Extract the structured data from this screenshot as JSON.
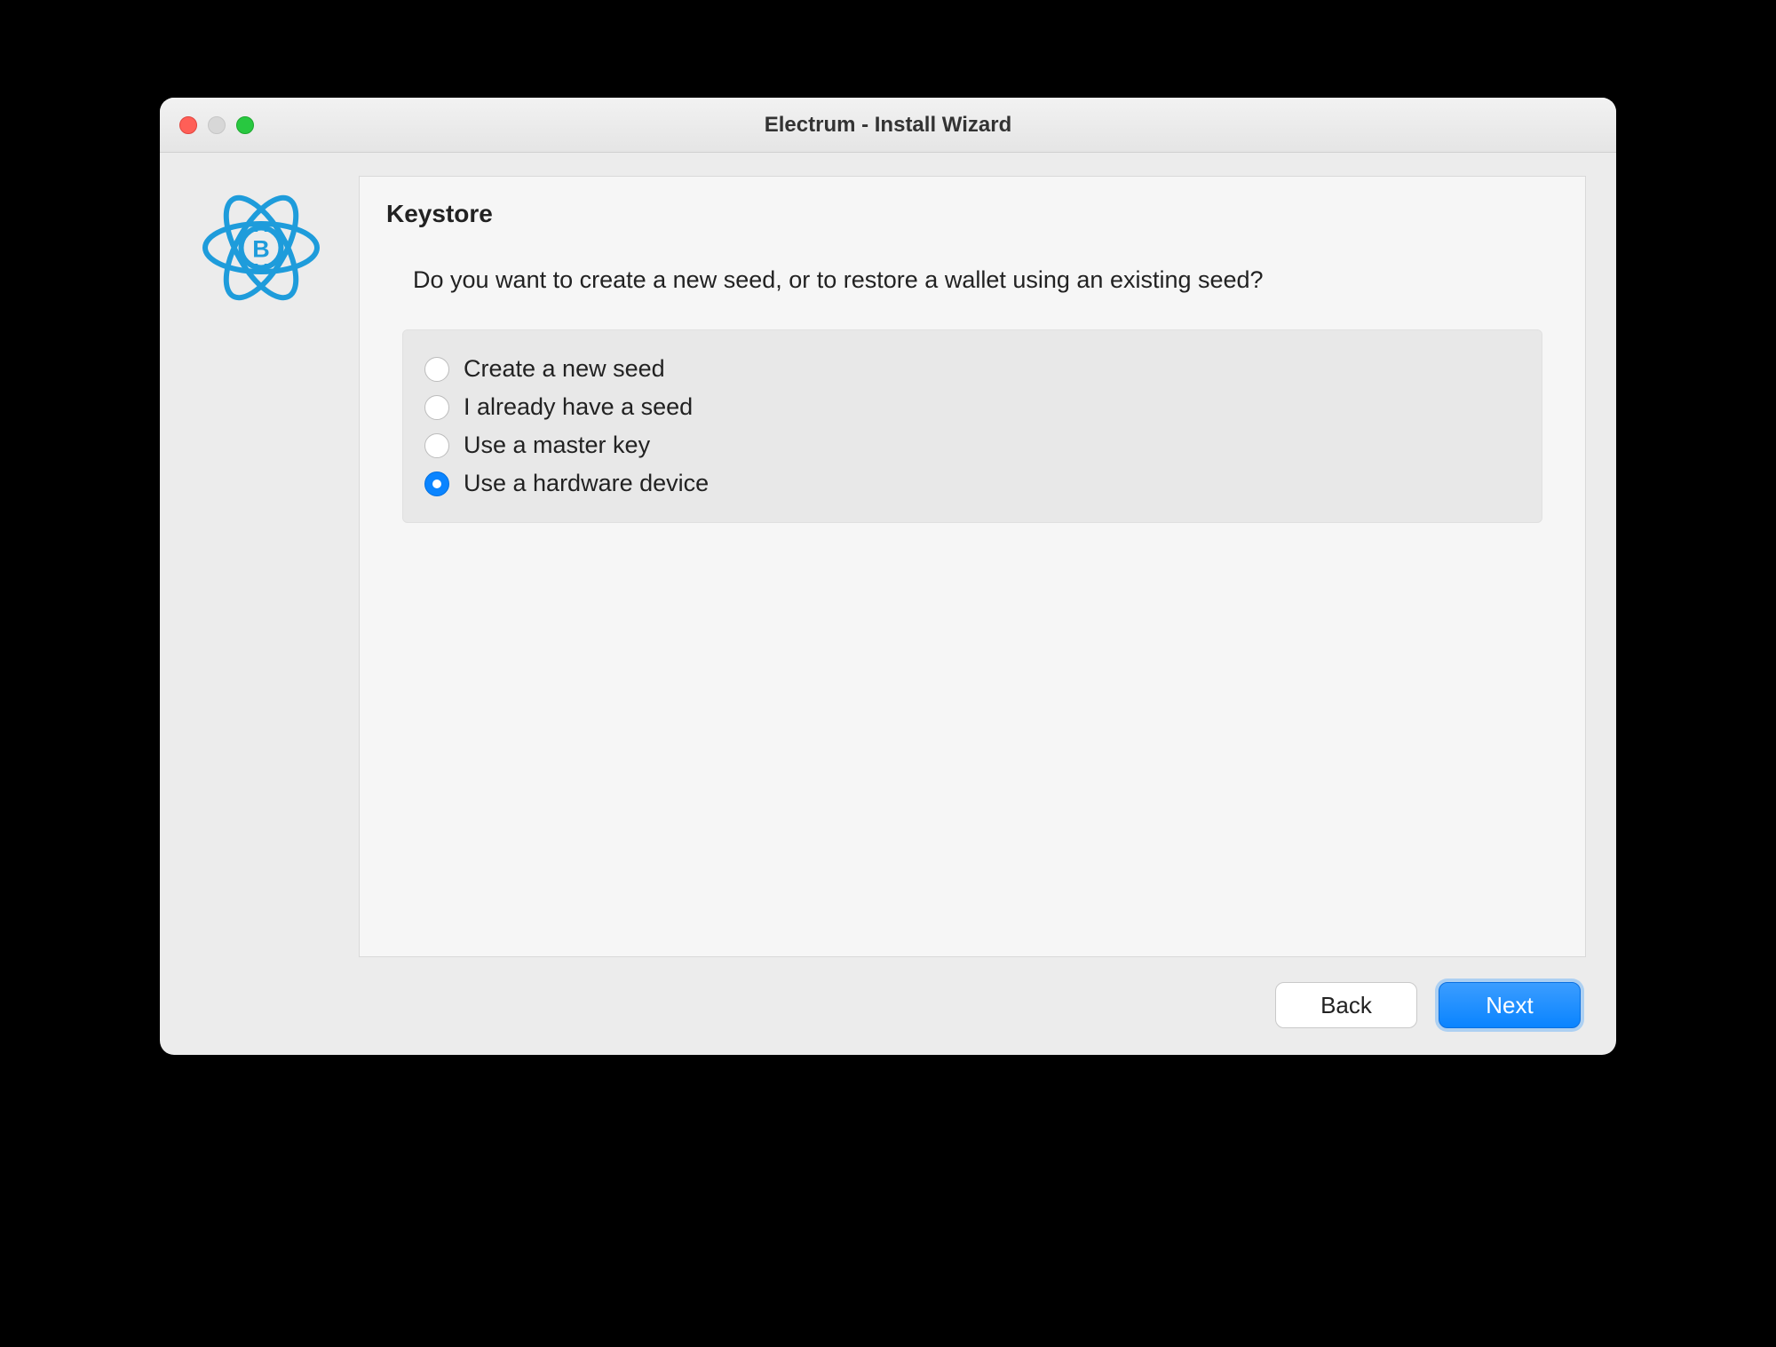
{
  "window": {
    "title": "Electrum  -  Install Wizard"
  },
  "panel": {
    "heading": "Keystore",
    "question": "Do you want to create a new seed, or to restore a wallet using an existing seed?"
  },
  "options": [
    {
      "label": "Create a new seed",
      "selected": false
    },
    {
      "label": "I already have a seed",
      "selected": false
    },
    {
      "label": "Use a master key",
      "selected": false
    },
    {
      "label": "Use a hardware device",
      "selected": true
    }
  ],
  "buttons": {
    "back": "Back",
    "next": "Next"
  }
}
